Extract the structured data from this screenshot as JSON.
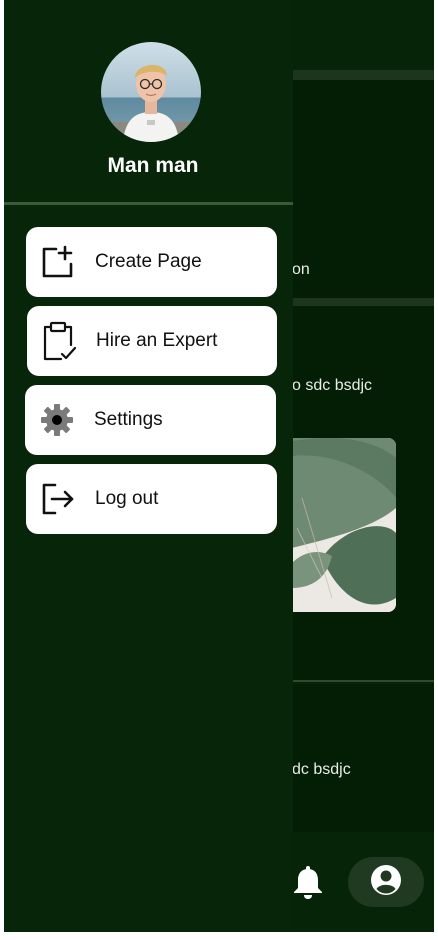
{
  "drawer": {
    "user_name": "Man man",
    "menu": [
      {
        "label": "Create Page",
        "icon": "add-page-icon"
      },
      {
        "label": "Hire an Expert",
        "icon": "clipboard-check-icon"
      },
      {
        "label": "Settings",
        "icon": "gear-icon"
      },
      {
        "label": "Log out",
        "icon": "logout-icon"
      }
    ]
  },
  "feed": {
    "text_1": "on",
    "text_2": "o sdc bsdjc",
    "text_3": "dc bsdjc"
  },
  "bottom_nav": {
    "icons": [
      "bell-icon",
      "account-icon"
    ]
  },
  "colors": {
    "drawer_bg": "#072508",
    "app_bg": "#062407",
    "menu_item_bg": "#ffffff",
    "profile_pill_bg": "#1f3a20"
  }
}
